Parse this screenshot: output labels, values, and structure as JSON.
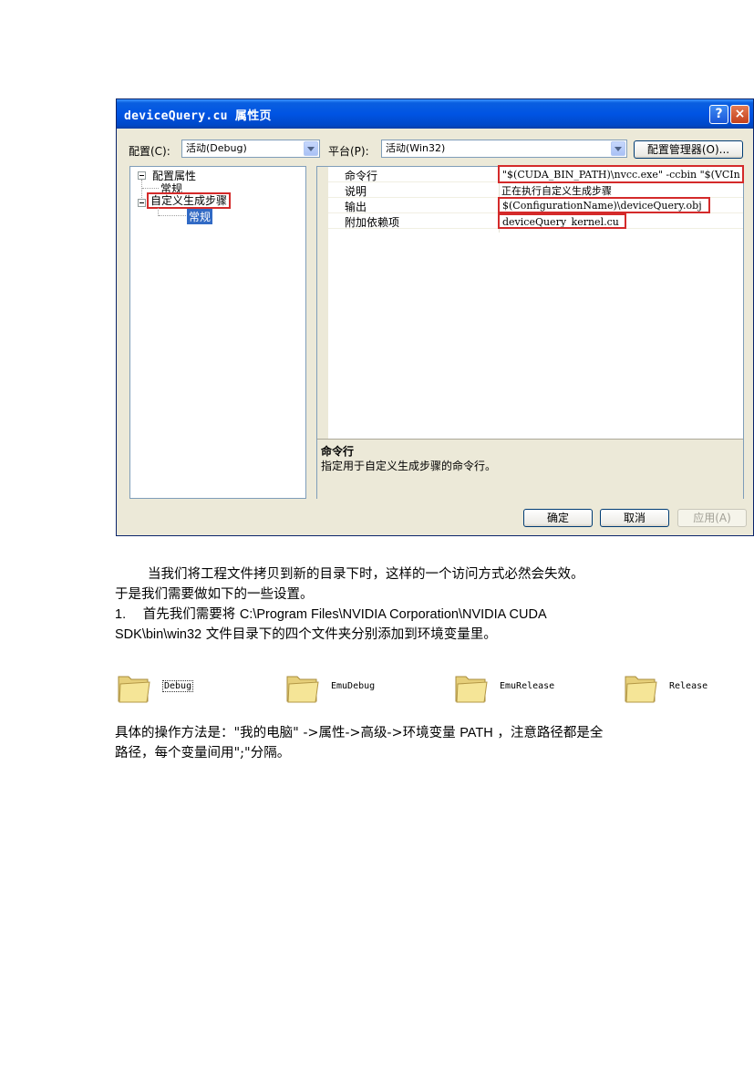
{
  "dialog": {
    "title": "deviceQuery.cu 属性页",
    "help_label": "?",
    "close_label": "×",
    "config_label": "配置(C):",
    "config_value": "活动(Debug)",
    "platform_label": "平台(P):",
    "platform_value": "活动(Win32)",
    "config_manager_button": "配置管理器(O)...",
    "tree": {
      "root": "配置属性",
      "child_general": "常规",
      "custom_build": "自定义生成步骤",
      "custom_build_general": "常规"
    },
    "properties": [
      {
        "name": "命令行",
        "value": "\"$(CUDA_BIN_PATH)\\nvcc.exe\" -ccbin \"$(VCIn"
      },
      {
        "name": "说明",
        "value": "正在执行自定义生成步骤"
      },
      {
        "name": "输出",
        "value": "$(ConfigurationName)\\deviceQuery.obj"
      },
      {
        "name": "附加依赖项",
        "value": "deviceQuery_kernel.cu"
      }
    ],
    "description": {
      "title": "命令行",
      "text": "指定用于自定义生成步骤的命令行。"
    },
    "buttons": {
      "ok": "确定",
      "cancel": "取消",
      "apply": "应用(A)"
    },
    "highlight_color": "#d42a2a"
  },
  "paragraphs": {
    "p1_line1": "当我们将工程文件拷贝到新的目录下时，这样的一个访问方式必然会失效。",
    "p1_line2": "于是我们需要做如下的一些设置。",
    "p2_number": "1.",
    "p2_text_a": "首先我们需要将",
    "p2_path_a": "C:\\Program Files\\NVIDIA Corporation\\NVIDIA CUDA",
    "p2_path_b": "SDK\\bin\\win32",
    "p2_text_b": "文件目录下的四个文件夹分别添加到环境变量里。",
    "p3_line1_a": "具体的操作方法是：\"我的电脑\" ->属性->高级->环境变量",
    "p3_line1_path": "PATH",
    "p3_line1_b": "，注意路径都是全",
    "p3_line2": "路径，每个变量间用\";\"分隔。"
  },
  "folders": [
    {
      "label": "Debug",
      "icon": "folder-icon"
    },
    {
      "label": "EmuDebug",
      "icon": "folder-icon"
    },
    {
      "label": "EmuRelease",
      "icon": "folder-icon"
    },
    {
      "label": "Release",
      "icon": "folder-icon"
    }
  ]
}
